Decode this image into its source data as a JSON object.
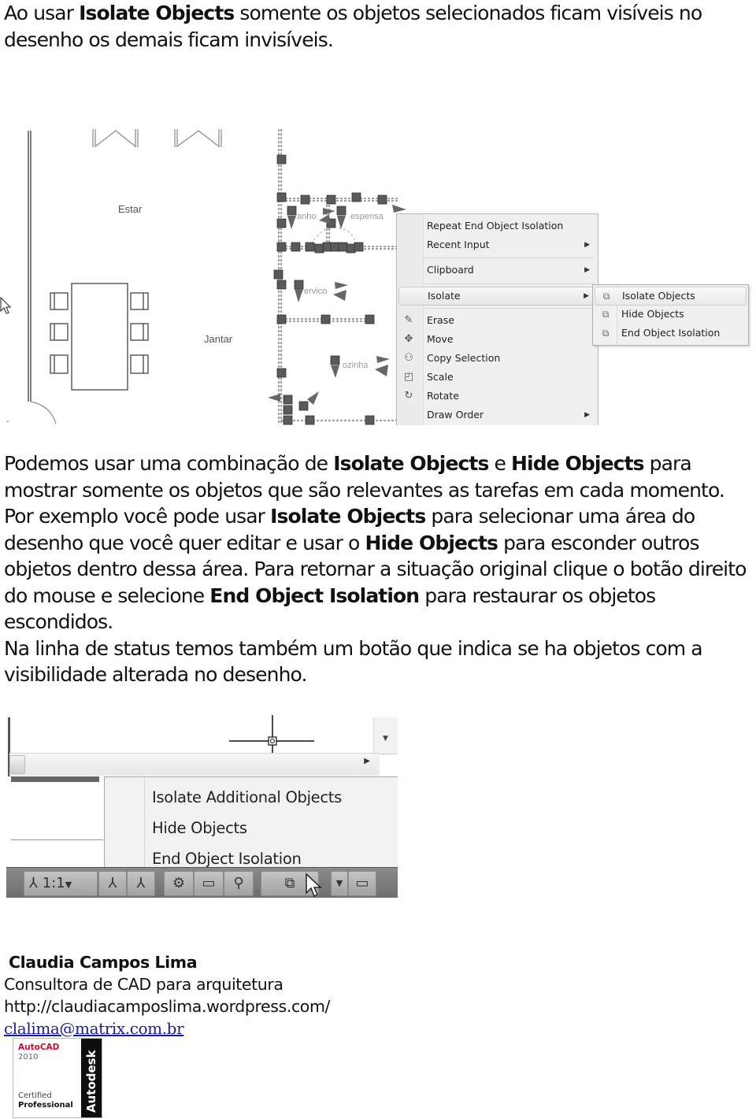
{
  "paragraph1": {
    "pre": "Ao usar ",
    "bold1": "Isolate Objects",
    "post": " somente os objetos selecionados ficam visíveis no desenho os demais ficam invisíveis."
  },
  "figure1": {
    "room_labels": [
      "Estar",
      "Jantar",
      "anho",
      "espensa",
      "ervico",
      "ozinha"
    ],
    "context_menu": {
      "items": [
        {
          "label": "Repeat End Object Isolation",
          "icon": "",
          "submenu": false
        },
        {
          "label": "Recent Input",
          "icon": "",
          "submenu": true
        },
        {
          "label": "Clipboard",
          "icon": "",
          "submenu": true
        },
        {
          "label": "Isolate",
          "icon": "",
          "submenu": true,
          "highlighted": true
        },
        {
          "label": "Erase",
          "icon": "eraser-icon",
          "submenu": false
        },
        {
          "label": "Move",
          "icon": "move-icon",
          "submenu": false
        },
        {
          "label": "Copy Selection",
          "icon": "copy-selection-icon",
          "submenu": false
        },
        {
          "label": "Scale",
          "icon": "scale-icon",
          "submenu": false
        },
        {
          "label": "Rotate",
          "icon": "rotate-icon",
          "submenu": false
        },
        {
          "label": "Draw Order",
          "icon": "",
          "submenu": true
        }
      ],
      "arrow_glyph": "▶"
    },
    "submenu": {
      "items": [
        {
          "label": "Isolate Objects",
          "icon": "isolate-objects-icon",
          "highlighted": true
        },
        {
          "label": "Hide Objects",
          "icon": "hide-objects-icon"
        },
        {
          "label": "End Object Isolation",
          "icon": "end-isolation-icon"
        }
      ]
    }
  },
  "paragraph2": {
    "segments": [
      {
        "text": "Podemos usar uma combinação de ",
        "bold": false
      },
      {
        "text": "Isolate Objects",
        "bold": true
      },
      {
        "text": " e ",
        "bold": false
      },
      {
        "text": "Hide Objects",
        "bold": true
      },
      {
        "text": " para mostrar somente os objetos que são relevantes as tarefas em cada momento. Por exemplo você pode usar ",
        "bold": false
      },
      {
        "text": "Isolate Objects",
        "bold": true
      },
      {
        "text": "  para selecionar uma área do desenho que você quer editar e usar o ",
        "bold": false
      },
      {
        "text": "Hide Objects",
        "bold": true
      },
      {
        "text": " para esconder outros objetos dentro dessa área. Para retornar a situação original clique o botão direito do mouse e  selecione ",
        "bold": false
      },
      {
        "text": "End Object Isolation",
        "bold": true
      },
      {
        "text": " para restaurar os objetos escondidos.",
        "bold": false
      }
    ],
    "last_line": "Na linha de status temos também um botão que indica se ha objetos com a visibilidade alterada no desenho."
  },
  "figure2": {
    "menu_items": [
      "Isolate Additional Objects",
      "Hide Objects",
      "End Object Isolation"
    ],
    "annotation_scale": "1:1",
    "scroll_right_glyph": "▶",
    "dropdown_glyph": "▼"
  },
  "signature": {
    "name": "Claudia Campos Lima",
    "role": "Consultora de CAD para arquitetura",
    "website": "http://claudiacamposlima.wordpress.com/",
    "email": "clalima@matrix.com.br"
  },
  "badge": {
    "product": "AutoCAD",
    "year": "2010",
    "cert_line1": "Certified",
    "cert_line2": "Professional",
    "vendor": "Autodesk",
    "brand_color": "#c8102e"
  }
}
